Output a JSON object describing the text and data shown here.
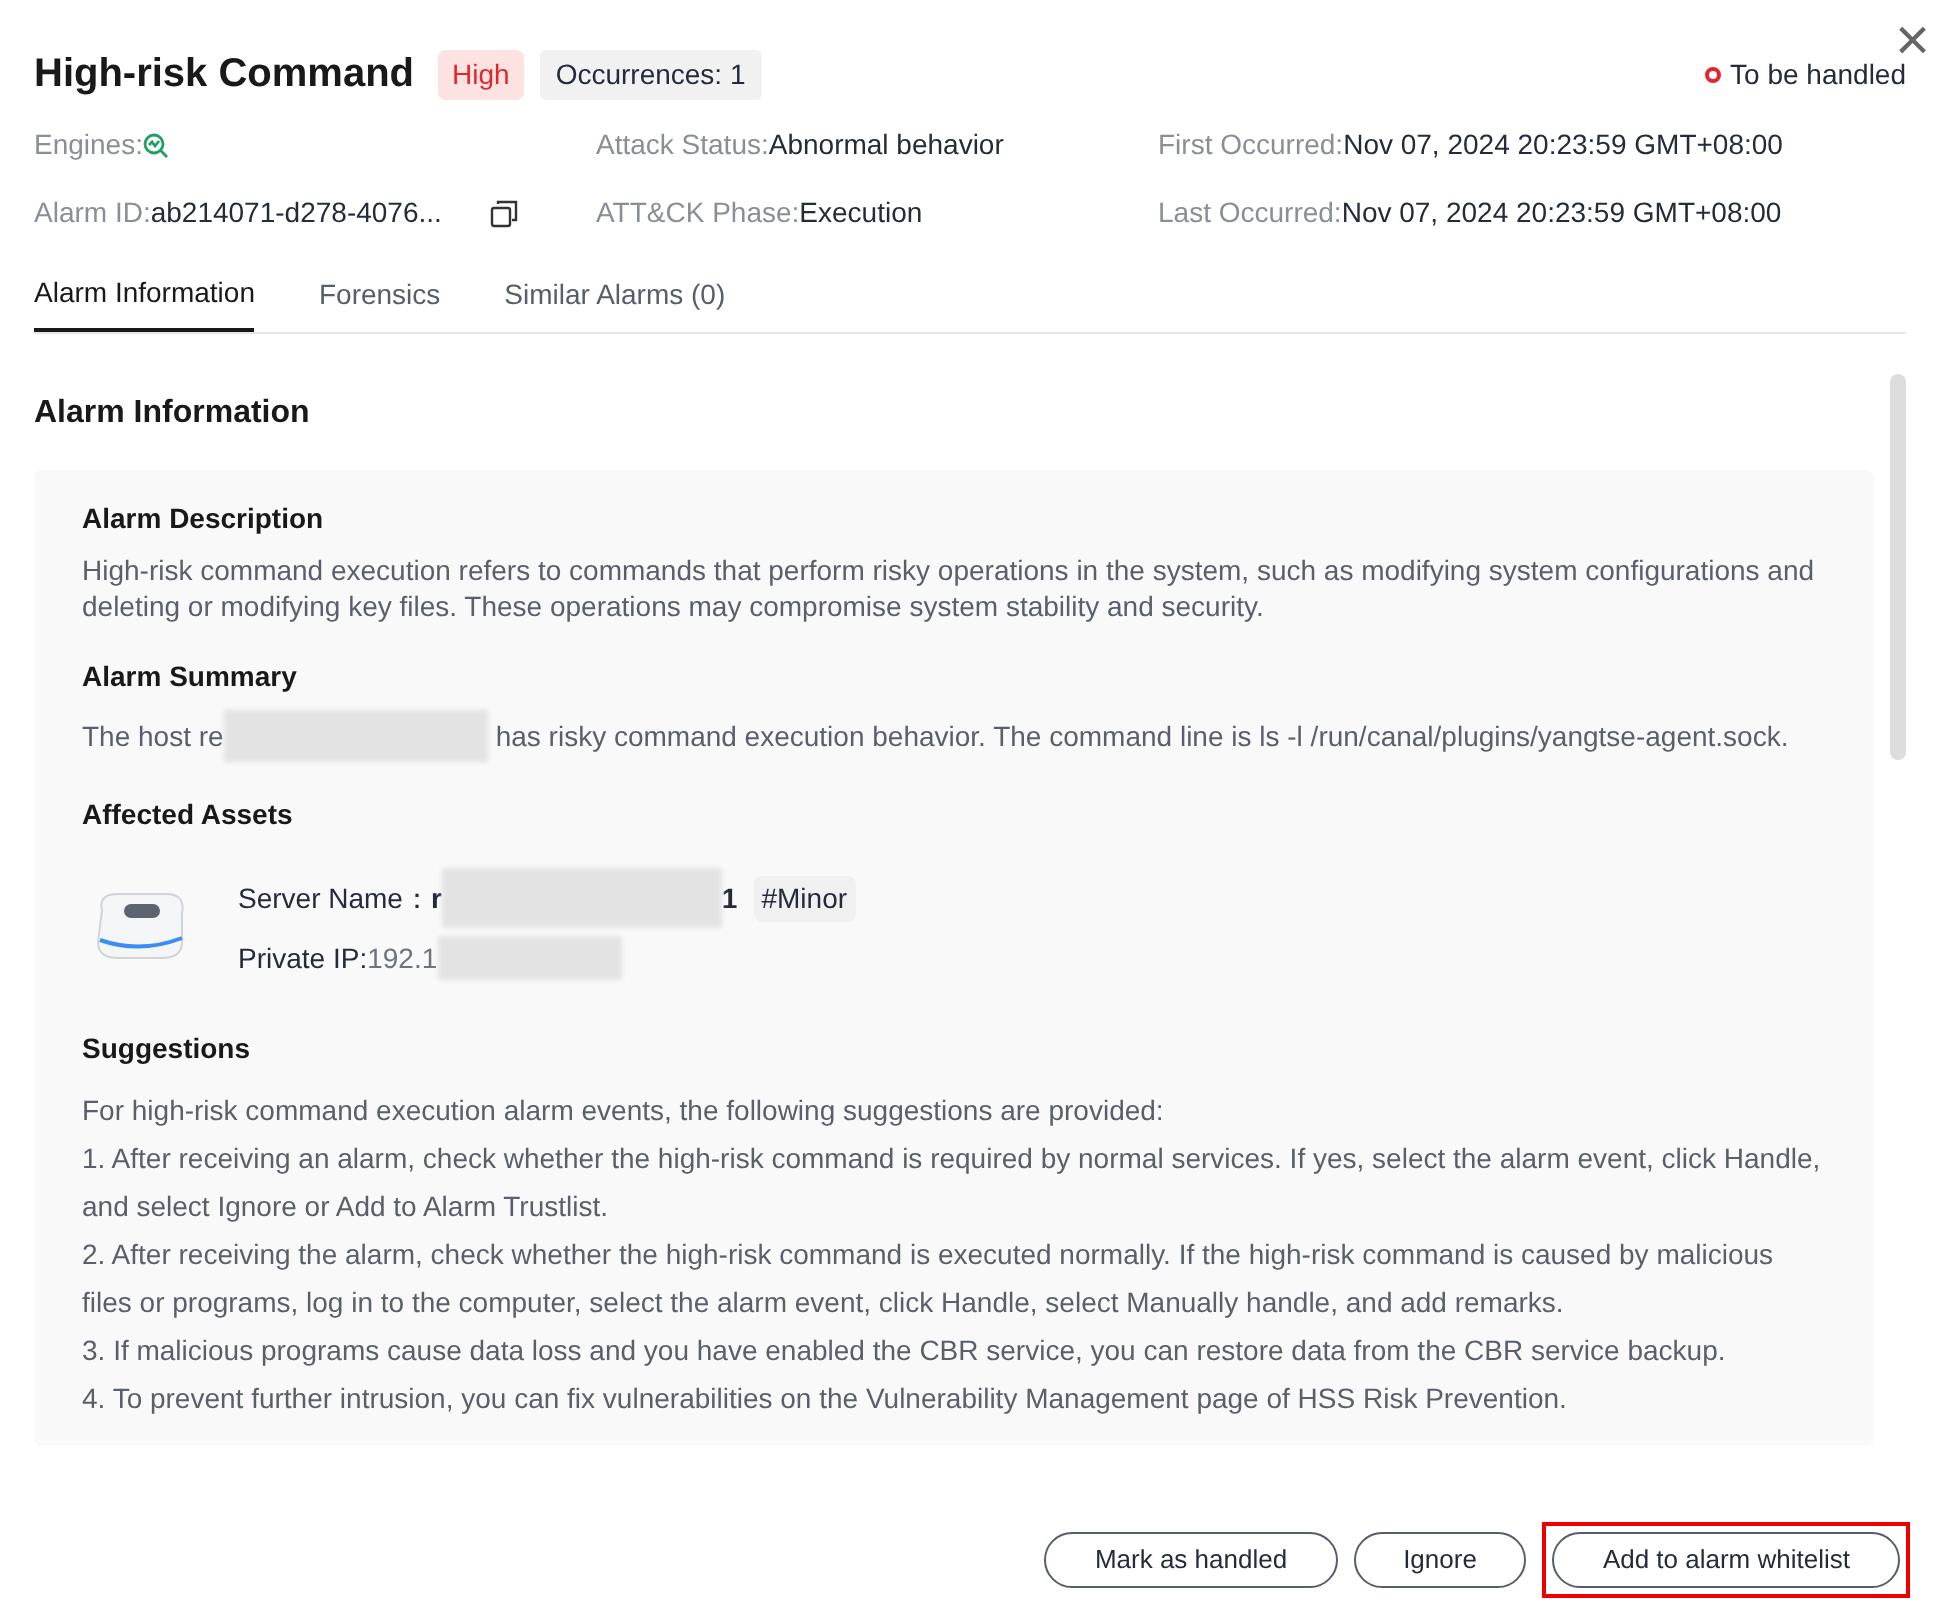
{
  "header": {
    "title": "High-risk Command",
    "severity": "High",
    "occurrences": "Occurrences: 1",
    "status": "To be handled",
    "close": "×"
  },
  "meta": [
    {
      "label": "Engines:",
      "kind": "icon"
    },
    {
      "label": "Attack Status:",
      "value": "Abnormal behavior",
      "kind": "text"
    },
    {
      "label": "First Occurred:",
      "value": "Nov 07, 2024 20:23:59 GMT+08:00",
      "kind": "text"
    },
    {
      "label": "Alarm ID:",
      "value": "ab214071-d278-4076...",
      "kind": "copy"
    },
    {
      "label": "ATT&CK Phase:",
      "value": "Execution",
      "kind": "text"
    },
    {
      "label": "Last Occurred:",
      "value": "Nov 07, 2024 20:23:59 GMT+08:00",
      "kind": "text"
    }
  ],
  "tabs": [
    {
      "label": "Alarm Information",
      "selected": true
    },
    {
      "label": "Forensics",
      "selected": false
    },
    {
      "label": "Similar Alarms  (0)",
      "selected": false
    }
  ],
  "section_title": "Alarm Information",
  "description": {
    "title": "Alarm Description",
    "text": "High-risk command execution refers to commands that perform risky operations in the system, such as modifying system configurations and deleting or modifying key files. These operations may compromise system stability and security."
  },
  "summary": {
    "title": "Alarm Summary",
    "before": "The host re",
    "after": "has risky command execution behavior. The command line is ls -l /run/canal/plugins/yangtse-agent.sock."
  },
  "assets": {
    "title": "Affected Assets",
    "server_label": "Server Name：",
    "server_start": "r",
    "server_end": "1",
    "tag": "#Minor",
    "ip_label": "Private IP:",
    "ip_value": "192.1"
  },
  "suggestions": {
    "title": "Suggestions",
    "lines": [
      "For high-risk command execution alarm events, the following suggestions are provided:",
      "1. After receiving an alarm, check whether the high-risk command is required by normal services. If yes, select the alarm event, click Handle, and select Ignore or Add to Alarm Trustlist.",
      "2. After receiving the alarm, check whether the high-risk command is executed normally. If the high-risk command is caused by malicious files or programs, log in to the computer, select the alarm event, click Handle, select Manually handle, and add remarks.",
      "3. If malicious programs cause data loss and you have enabled the CBR service, you can restore data from the CBR service backup.",
      "4. To prevent further intrusion, you can fix vulnerabilities on the Vulnerability Management page of HSS Risk Prevention."
    ]
  },
  "buttons": [
    {
      "label": "Mark as handled",
      "highlighted": false
    },
    {
      "label": "Ignore",
      "highlighted": false
    },
    {
      "label": "Add to alarm whitelist",
      "highlighted": true
    }
  ]
}
